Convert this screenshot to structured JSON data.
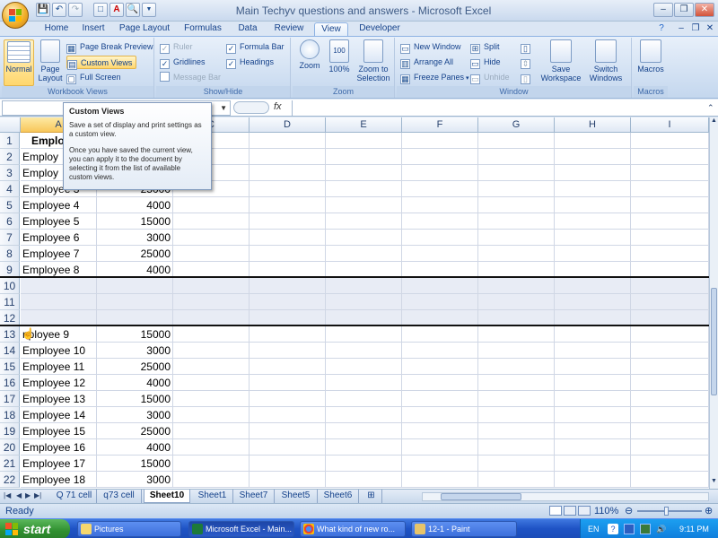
{
  "window": {
    "title": "Main Techyv questions and answers - Microsoft Excel",
    "controls": {
      "minimize": "–",
      "restore": "❐",
      "close": "✕",
      "help": "?"
    }
  },
  "qat": {
    "save": "💾",
    "undo": "↶",
    "redo": "↷",
    "new": "□",
    "print": "A",
    "preview": "🔍"
  },
  "tabs": [
    "Home",
    "Insert",
    "Page Layout",
    "Formulas",
    "Data",
    "Review",
    "View",
    "Developer"
  ],
  "ribbon": {
    "workbook_views": {
      "label": "Workbook Views",
      "normal": "Normal",
      "page_layout": "Page Layout",
      "page_break_preview": "Page Break Preview",
      "custom_views": "Custom Views",
      "full_screen": "Full Screen"
    },
    "show_hide": {
      "label": "Show/Hide",
      "ruler": "Ruler",
      "gridlines": "Gridlines",
      "message_bar": "Message Bar",
      "formula_bar": "Formula Bar",
      "headings": "Headings"
    },
    "zoom": {
      "label": "Zoom",
      "zoom": "Zoom",
      "hundred": "100%",
      "zoom_to_selection": "Zoom to Selection"
    },
    "window": {
      "label": "Window",
      "new_window": "New Window",
      "arrange_all": "Arrange All",
      "freeze_panes": "Freeze Panes",
      "split": "Split",
      "hide": "Hide",
      "unhide": "Unhide",
      "save_workspace": "Save Workspace",
      "switch_windows": "Switch Windows"
    },
    "macros": {
      "label": "Macros",
      "macros": "Macros"
    }
  },
  "formula_bar": {
    "fx": "fx",
    "value": ""
  },
  "tooltip": {
    "title": "Custom Views",
    "p1": "Save a set of display and print settings as a custom view.",
    "p2": "Once you have saved the current view, you can apply it to the document by selecting it from the list of available custom views."
  },
  "columns": [
    "A",
    "B",
    "C",
    "D",
    "E",
    "F",
    "G",
    "H",
    "I"
  ],
  "rows": [
    {
      "n": "1",
      "a": "Emplo",
      "b": ""
    },
    {
      "n": "2",
      "a": "Employ",
      "b": ""
    },
    {
      "n": "3",
      "a": "Employ",
      "b": ""
    },
    {
      "n": "4",
      "a": "Employee 3",
      "b": "25000"
    },
    {
      "n": "5",
      "a": "Employee 4",
      "b": "4000"
    },
    {
      "n": "6",
      "a": "Employee 5",
      "b": "15000"
    },
    {
      "n": "7",
      "a": "Employee 6",
      "b": "3000"
    },
    {
      "n": "8",
      "a": "Employee 7",
      "b": "25000"
    },
    {
      "n": "9",
      "a": "Employee 8",
      "b": "4000"
    },
    {
      "n": "10",
      "a": "",
      "b": ""
    },
    {
      "n": "11",
      "a": "",
      "b": ""
    },
    {
      "n": "12",
      "a": "",
      "b": ""
    },
    {
      "n": "13",
      "a": "nployee 9",
      "b": "15000"
    },
    {
      "n": "14",
      "a": "Employee 10",
      "b": "3000"
    },
    {
      "n": "15",
      "a": "Employee 11",
      "b": "25000"
    },
    {
      "n": "16",
      "a": "Employee 12",
      "b": "4000"
    },
    {
      "n": "17",
      "a": "Employee 13",
      "b": "15000"
    },
    {
      "n": "18",
      "a": "Employee 14",
      "b": "3000"
    },
    {
      "n": "19",
      "a": "Employee 15",
      "b": "25000"
    },
    {
      "n": "20",
      "a": "Employee 16",
      "b": "4000"
    },
    {
      "n": "21",
      "a": "Employee 17",
      "b": "15000"
    },
    {
      "n": "22",
      "a": "Employee 18",
      "b": "3000"
    }
  ],
  "sheet_tabs": [
    "Q 71 cell",
    "q73 cell",
    "Sheet10",
    "Sheet1",
    "Sheet7",
    "Sheet5",
    "Sheet6"
  ],
  "active_sheet": "Sheet10",
  "status": {
    "ready": "Ready",
    "zoom": "110%"
  },
  "taskbar": {
    "start": "start",
    "items": [
      "Pictures",
      "Microsoft Excel - Main...",
      "What kind of new ro...",
      "12-1 - Paint"
    ],
    "lang": "EN",
    "clock": "9:11 PM"
  }
}
